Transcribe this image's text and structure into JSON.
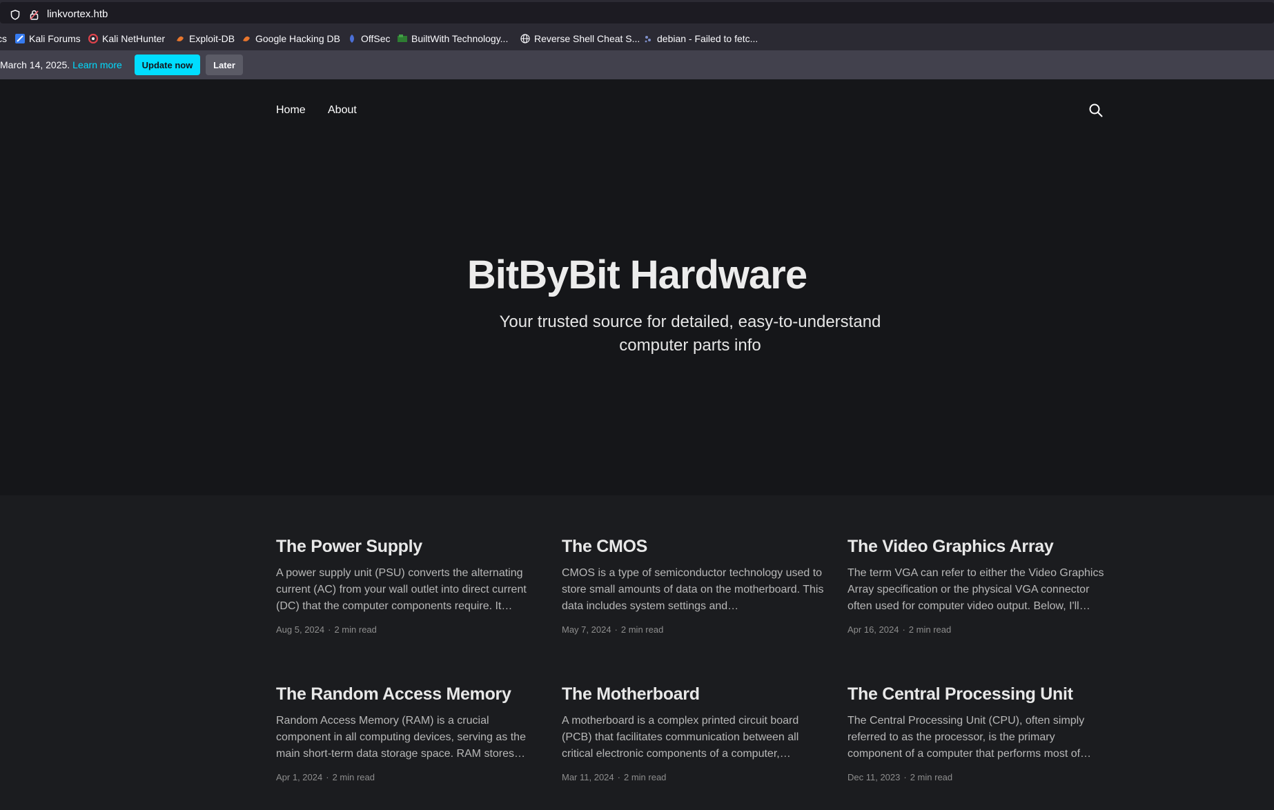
{
  "browser": {
    "url": "linkvortex.htb",
    "bookmarks": [
      {
        "label": "cs",
        "icon": "folder-icon"
      },
      {
        "label": "Kali Forums",
        "icon": "kali-forums-icon"
      },
      {
        "label": "Kali NetHunter",
        "icon": "kali-nethunter-icon"
      },
      {
        "label": "Exploit-DB",
        "icon": "exploit-db-icon"
      },
      {
        "label": "Google Hacking DB",
        "icon": "ghdb-icon"
      },
      {
        "label": "OffSec",
        "icon": "offsec-icon"
      },
      {
        "label": "BuiltWith Technology...",
        "icon": "builtwith-icon"
      },
      {
        "label": "Reverse Shell Cheat S...",
        "icon": "globe-icon"
      },
      {
        "label": "debian - Failed to fetc...",
        "icon": "debian-icon"
      }
    ],
    "notice": {
      "text": "March 14, 2025.",
      "link": "Learn more",
      "update_label": "Update now",
      "later_label": "Later"
    }
  },
  "site": {
    "nav": {
      "home": "Home",
      "about": "About"
    },
    "hero": {
      "title": "BitByBit Hardware",
      "subtitle": "Your trusted source for detailed, easy-to-understand computer parts info"
    },
    "posts": [
      {
        "title": "The Power Supply",
        "excerpt": "A power supply unit (PSU) converts the alternating current (AC) from your wall outlet into direct current (DC) that the computer components require. It…",
        "date": "Aug 5, 2024",
        "read": "2 min read"
      },
      {
        "title": "The CMOS",
        "excerpt": "CMOS is a type of semiconductor technology used to store small amounts of data on the motherboard. This data includes system settings and…",
        "date": "May 7, 2024",
        "read": "2 min read"
      },
      {
        "title": "The Video Graphics Array",
        "excerpt": "The term VGA can refer to either the Video Graphics Array specification or the physical VGA connector often used for computer video output. Below, I'll…",
        "date": "Apr 16, 2024",
        "read": "2 min read"
      },
      {
        "title": "The Random Access Memory",
        "excerpt": "Random Access Memory (RAM) is a crucial component in all computing devices, serving as the main short-term data storage space. RAM stores…",
        "date": "Apr 1, 2024",
        "read": "2 min read"
      },
      {
        "title": "The Motherboard",
        "excerpt": "A motherboard is a complex printed circuit board (PCB) that facilitates communication between all critical electronic components of a computer,…",
        "date": "Mar 11, 2024",
        "read": "2 min read"
      },
      {
        "title": "The Central Processing Unit",
        "excerpt": "The Central Processing Unit (CPU), often simply referred to as the processor, is the primary component of a computer that performs most of…",
        "date": "Dec 11, 2023",
        "read": "2 min read"
      }
    ]
  }
}
